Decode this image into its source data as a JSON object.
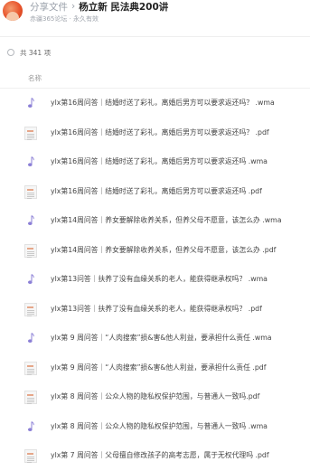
{
  "header": {
    "breadcrumb_parent": "分享文件",
    "breadcrumb_sep": "›",
    "title": "杨立新 民法典200讲",
    "subline": "赤疆365论坛 · 永久有效"
  },
  "toolbar": {
    "count_label": "共 341 项"
  },
  "table": {
    "column_name": "名称"
  },
  "icon_colors": {
    "audio": "#8b7fd6",
    "pdf_band": "#e6a78a"
  },
  "files": [
    {
      "name": "ylx第16周问答｜结婚时送了彩礼，离婚后男方可以要求返还吗？ .wma",
      "type": "audio",
      "icon": "music-note-icon"
    },
    {
      "name": "ylx第16周问答｜结婚时送了彩礼，离婚后男方可以要求返还吗？ .pdf",
      "type": "pdf",
      "icon": "pdf-document-icon"
    },
    {
      "name": "ylx第16周问答｜结婚时送了彩礼，离婚后男方可以要求返还吗 .wma",
      "type": "audio",
      "icon": "music-note-icon"
    },
    {
      "name": "ylx第16周问答｜结婚时送了彩礼，离婚后男方可以要求返还吗 .pdf",
      "type": "pdf",
      "icon": "pdf-document-icon"
    },
    {
      "name": "ylx第14周问答｜养女要解除收养关系，但养父母不愿意，该怎么办 .wma",
      "type": "audio",
      "icon": "music-note-icon"
    },
    {
      "name": "ylx第14周问答｜养女要解除收养关系，但养父母不愿意，该怎么办 .pdf",
      "type": "pdf",
      "icon": "pdf-document-icon"
    },
    {
      "name": "ylx第13问答｜扶养了没有血缘关系的老人，能获得继承权吗？ .wma",
      "type": "audio",
      "icon": "music-note-icon"
    },
    {
      "name": "ylx第13问答｜扶养了没有血缘关系的老人，能获得继承权吗？ .pdf",
      "type": "pdf",
      "icon": "pdf-document-icon"
    },
    {
      "name": "ylx第 9 周问答｜“人肉搜索”损&害&他人利益，要承担什么责任 .wma",
      "type": "audio",
      "icon": "music-note-icon"
    },
    {
      "name": "ylx第 9 周问答｜“人肉搜索”损&害&他人利益，要承担什么责任 .pdf",
      "type": "pdf",
      "icon": "pdf-document-icon"
    },
    {
      "name": "ylx第 8 周问答｜公众人物的隐私权保护范围，与普通人一致吗.pdf",
      "type": "pdf",
      "icon": "pdf-document-icon"
    },
    {
      "name": "ylx第 8 周问答｜公众人物的隐私权保护范围，与普通人一致吗 .wma",
      "type": "audio",
      "icon": "music-note-icon"
    },
    {
      "name": "ylx第 7 周问答｜父母擅自修改孩子的高考志愿，属于无权代理吗 .pdf",
      "type": "pdf",
      "icon": "pdf-document-icon"
    }
  ]
}
